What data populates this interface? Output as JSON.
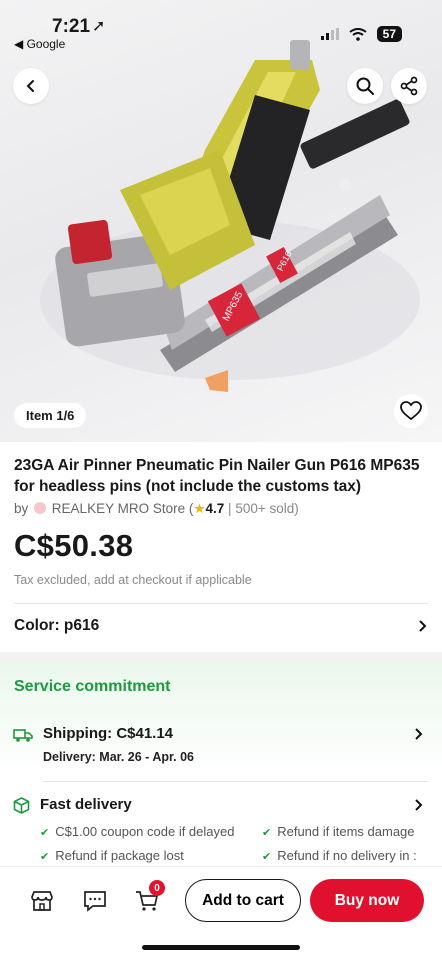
{
  "status": {
    "time": "7:21",
    "back_app": "◀ Google",
    "battery": "57"
  },
  "gallery": {
    "item_counter": "Item 1/6"
  },
  "product": {
    "title": "23GA Air Pinner Pneumatic Pin Nailer Gun P616 MP635 for headless pins (not include the customs tax)",
    "by": "by",
    "store_name": "REALKEY MRO Store",
    "rating": "4.7",
    "sold": "500+ sold",
    "price": "C$50.38",
    "tax_note": "Tax excluded, add at checkout if applicable",
    "color_label": "Color: p616",
    "label_mp635": "MP635",
    "label_p616": "P616"
  },
  "service": {
    "title": "Service commitment",
    "shipping": "Shipping: C$41.14",
    "delivery": "Delivery: Mar. 26 - Apr. 06",
    "fast_delivery": "Fast delivery",
    "perks": [
      "C$1.00 coupon code if delayed",
      "Refund if items damage",
      "Refund if package lost",
      "Refund if no delivery in :"
    ]
  },
  "bottom_bar": {
    "cart_count": "0",
    "add_to_cart": "Add to cart",
    "buy_now": "Buy now"
  },
  "colors": {
    "accent_red": "#e1102f",
    "service_green": "#1c9a3e",
    "tool_yellow": "#c9c43c"
  }
}
